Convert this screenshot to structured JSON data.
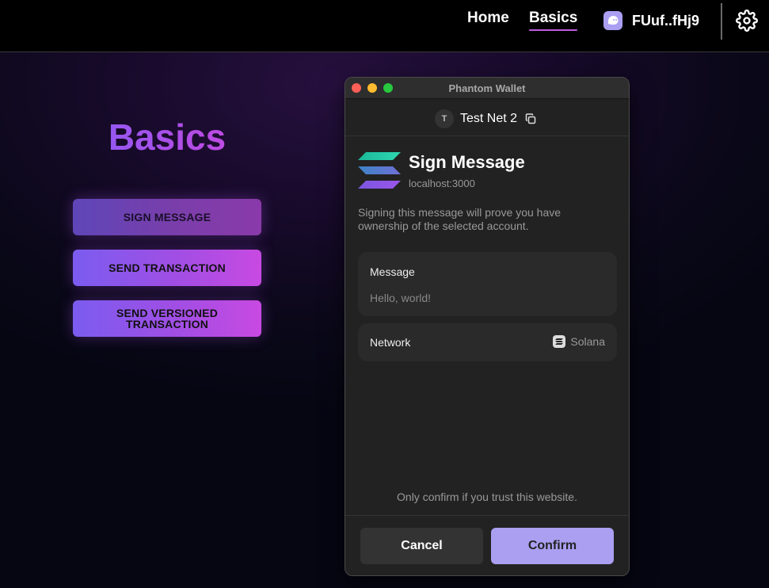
{
  "nav": {
    "home_label": "Home",
    "basics_label": "Basics",
    "wallet_address": "FUuf..fHj9",
    "wallet_icon": "phantom-ghost-icon",
    "settings_icon": "gear-icon"
  },
  "page": {
    "title": "Basics",
    "buttons": {
      "sign_message": "SIGN MESSAGE",
      "send_transaction": "SEND TRANSACTION",
      "send_versioned_transaction": "SEND VERSIONED TRANSACTION"
    }
  },
  "popup": {
    "window_title": "Phantom Wallet",
    "account": {
      "avatar_letter": "T",
      "name": "Test Net 2",
      "copy_icon": "copy-icon"
    },
    "request": {
      "title": "Sign Message",
      "origin": "localhost:3000",
      "description": "Signing this message will prove you have ownership of the selected account.",
      "logo_icon": "solana-logo-icon"
    },
    "message_card": {
      "label": "Message",
      "value": "Hello, world!"
    },
    "network_card": {
      "label": "Network",
      "value": "Solana"
    },
    "trust_note": "Only confirm if you trust this website.",
    "cancel_label": "Cancel",
    "confirm_label": "Confirm"
  },
  "colors": {
    "accent": "#ab9ff2",
    "gradient_start": "#7b5cf0",
    "gradient_end": "#c84ae2",
    "mac_close": "#fe5f57",
    "mac_minimize": "#febc2e",
    "mac_maximize": "#28c840"
  }
}
